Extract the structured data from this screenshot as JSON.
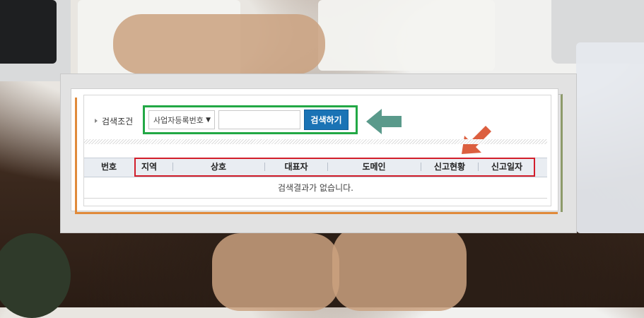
{
  "search": {
    "condition_label": "검색조건",
    "select_value": "사업자등록번호",
    "input_value": "",
    "button_label": "검색하기"
  },
  "table": {
    "columns": [
      "번호",
      "지역",
      "상호",
      "대표자",
      "도메인",
      "신고현황",
      "신고일자"
    ],
    "empty_message": "검색결과가 없습니다."
  },
  "annotations": {
    "green_arrow_color": "#5a9a8b",
    "orange_arrow_color": "#dc5f3f",
    "highlight_green": "#22a845",
    "highlight_red": "#d21e2b"
  }
}
